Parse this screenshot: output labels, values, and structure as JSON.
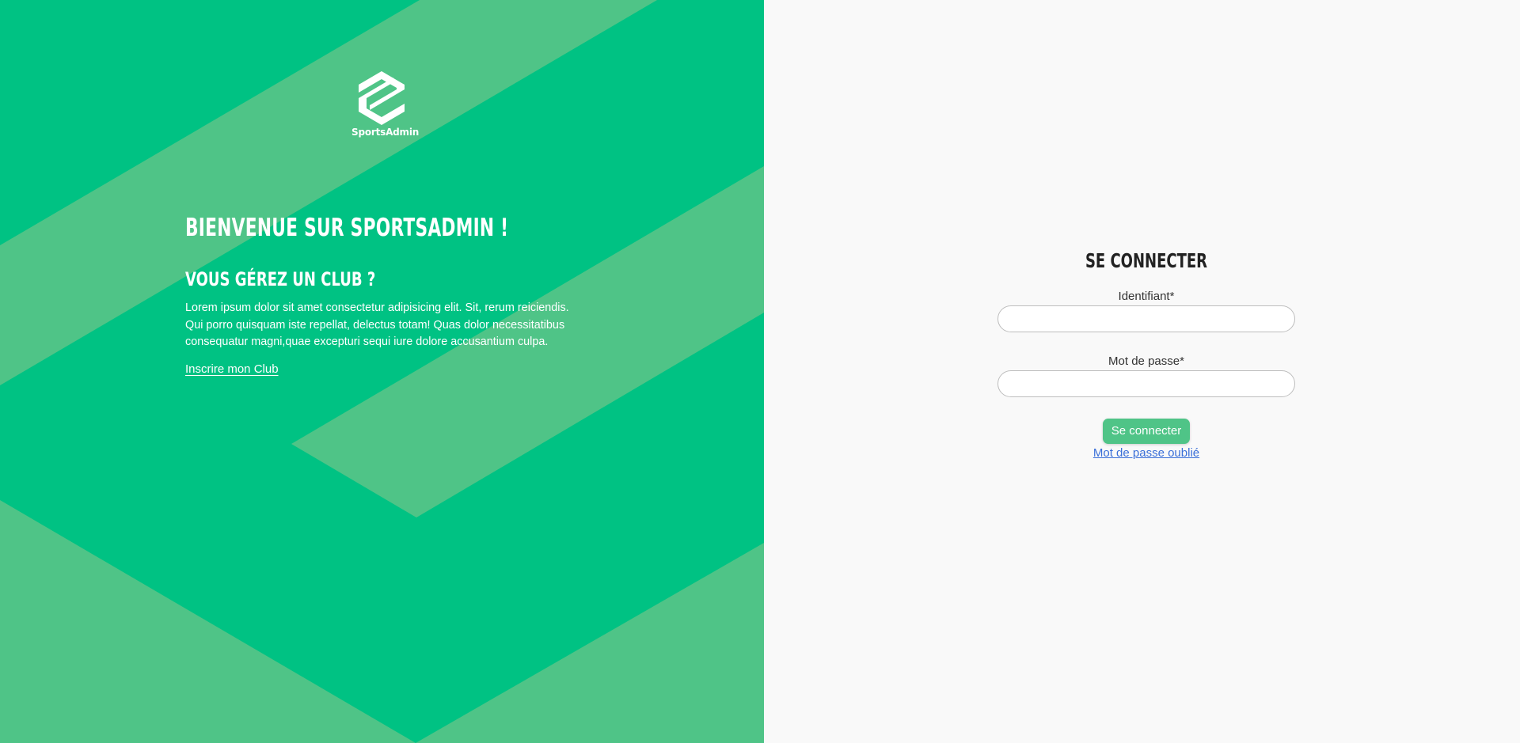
{
  "brand": {
    "name": "SportsAdmin",
    "primary_color": "#00c283",
    "stripe_color": "#4fc487",
    "logo_icon": "sportsadmin-logo-icon"
  },
  "welcome": {
    "title": "BIENVENUE SUR SPORTSADMIN !",
    "subtitle": "VOUS GÉREZ UN CLUB ?",
    "body": "Lorem ipsum dolor sit amet consectetur adipisicing elit. Sit, rerum reiciendis. Qui porro quisquam iste repellat, delectus totam! Quas dolor necessitatibus consequatur magni,quae excepturi sequi iure dolore accusantium culpa.",
    "register_link": "Inscrire mon Club"
  },
  "login": {
    "title": "SE CONNECTER",
    "username_label": "Identifiant*",
    "username_value": "",
    "password_label": "Mot de passe*",
    "password_value": "",
    "submit_label": "Se connecter",
    "submit_color": "#4fc487",
    "forgot_link": "Mot de passe oublié",
    "link_color": "#3a6fd8"
  }
}
